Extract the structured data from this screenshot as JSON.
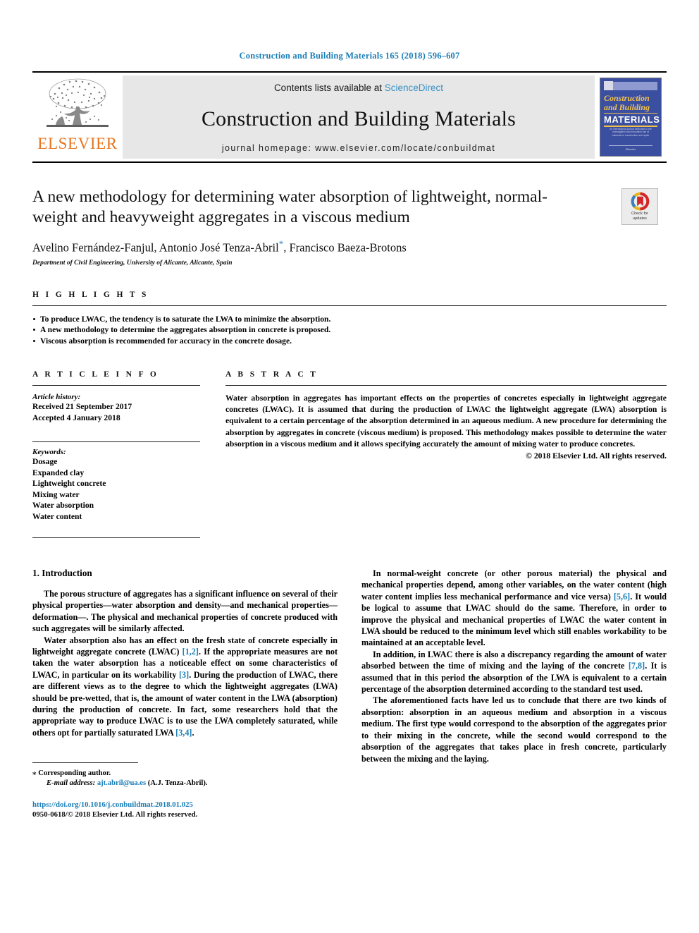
{
  "running_head": "Construction and Building Materials 165 (2018) 596–607",
  "masthead": {
    "publisher_name": "ELSEVIER",
    "contents_prefix": "Contents lists available at ",
    "contents_link": "ScienceDirect",
    "journal_title": "Construction and Building Materials",
    "homepage": "journal homepage: www.elsevier.com/locate/conbuildmat",
    "cover": {
      "line1": "Construction",
      "line2": "and Building",
      "line3": "MATERIALS",
      "blurb": "An international journal dedicated to the investigation and innovative use of materials in construction and repair",
      "footer": "Elsevier"
    }
  },
  "article": {
    "title": "A new methodology for determining water absorption of lightweight, normal-weight and heavyweight aggregates in a viscous medium",
    "authors": "Avelino Fernández-Fanjul, Antonio José Tenza-Abril",
    "authors_star": "*",
    "authors_tail": ", Francisco Baeza-Brotons",
    "affiliation": "Department of Civil Engineering, University of Alicante, Alicante, Spain",
    "crossmark_label_1": "Check for",
    "crossmark_label_2": "updates"
  },
  "highlights": {
    "label": "H I G H L I G H T S",
    "items": [
      "To produce LWAC, the tendency is to saturate the LWA to minimize the absorption.",
      "A new methodology to determine the aggregates absorption in concrete is proposed.",
      "Viscous absorption is recommended for accuracy in the concrete dosage."
    ]
  },
  "article_info": {
    "label": "A R T I C L E  I N F O",
    "history_head": "Article history:",
    "history": [
      "Received 21 September 2017",
      "Accepted 4 January 2018"
    ],
    "keywords_head": "Keywords:",
    "keywords": [
      "Dosage",
      "Expanded clay",
      "Lightweight concrete",
      "Mixing water",
      "Water absorption",
      "Water content"
    ]
  },
  "abstract": {
    "label": "A B S T R A C T",
    "text": "Water absorption in aggregates has important effects on the properties of concretes especially in lightweight aggregate concretes (LWAC). It is assumed that during the production of LWAC the lightweight aggregate (LWA) absorption is equivalent to a certain percentage of the absorption determined in an aqueous medium. A new procedure for determining the absorption by aggregates in concrete (viscous medium) is proposed. This methodology makes possible to determine the water absorption in a viscous medium and it allows specifying accurately the amount of mixing water to produce concretes.",
    "copyright": "© 2018 Elsevier Ltd. All rights reserved."
  },
  "introduction": {
    "heading": "1. Introduction",
    "left_paragraphs": [
      "The porous structure of aggregates has a significant influence on several of their physical properties—water absorption and density—and mechanical properties—deformation—. The physical and mechanical properties of concrete produced with such aggregates will be similarly affected.",
      "Water absorption also has an effect on the fresh state of concrete especially in lightweight aggregate concrete (LWAC) [1,2]. If the appropriate measures are not taken the water absorption has a noticeable effect on some characteristics of LWAC, in particular on its workability [3]. During the production of LWAC, there are different views as to the degree to which the lightweight aggregates (LWA) should be pre-wetted, that is, the amount of water content in the LWA (absorption) during the production of concrete. In fact, some researchers hold that the appropriate way to produce LWAC is to use the LWA completely saturated, while others opt for partially saturated LWA [3,4]."
    ],
    "right_paragraphs": [
      "In normal-weight concrete (or other porous material) the physical and mechanical properties depend, among other variables, on the water content (high water content implies less mechanical performance and vice versa) [5,6]. It would be logical to assume that LWAC should do the same. Therefore, in order to improve the physical and mechanical properties of LWAC the water content in LWA should be reduced to the minimum level which still enables workability to be maintained at an acceptable level.",
      "In addition, in LWAC there is also a discrepancy regarding the amount of water absorbed between the time of mixing and the laying of the concrete [7,8]. It is assumed that in this period the absorption of the LWA is equivalent to a certain percentage of the absorption determined according to the standard test used.",
      "The aforementioned facts have led us to conclude that there are two kinds of absorption: absorption in an aqueous medium and absorption in a viscous medium. The first type would correspond to the absorption of the aggregates prior to their mixing in the concrete, while the second would correspond to the absorption of the aggregates that takes place in fresh concrete, particularly between the mixing and the laying."
    ]
  },
  "footnote": {
    "corresponding": "⁎ Corresponding author.",
    "email_label": "E-mail address:",
    "email": "ajt.abril@ua.es",
    "email_tail": "(A.J. Tenza-Abril).",
    "doi": "https://doi.org/10.1016/j.conbuildmat.2018.01.025",
    "issn": "0950-0618/© 2018 Elsevier Ltd. All rights reserved."
  },
  "colors": {
    "link": "#1a7db6",
    "elsevier_orange": "#e87722",
    "sciencedirect": "#3a8fc4",
    "cover_blue": "#3b4fa0",
    "cover_yellow": "#f2c14b"
  }
}
